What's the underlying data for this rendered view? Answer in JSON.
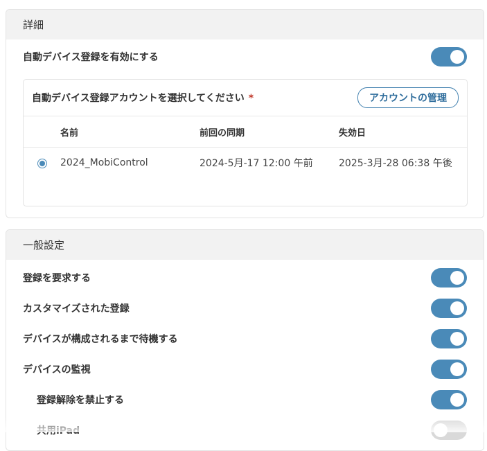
{
  "details": {
    "header": "詳細",
    "auto_enroll": {
      "label": "自動デバイス登録を有効にする",
      "enabled": true
    },
    "account_section": {
      "title": "自動デバイス登録アカウントを選択してください",
      "required_mark": "*",
      "manage_button": "アカウントの管理",
      "columns": [
        "名前",
        "前回の同期",
        "失効日"
      ],
      "rows": [
        {
          "selected": true,
          "name": "2024_MobiControl",
          "last_sync": "2024-5月-17 12:00 午前",
          "expires": "2025-3月-28 06:38 午後"
        }
      ]
    }
  },
  "general": {
    "header": "一般設定",
    "settings": [
      {
        "label": "登録を要求する",
        "enabled": true
      },
      {
        "label": "カスタマイズされた登録",
        "enabled": true
      },
      {
        "label": "デバイスが構成されるまで待機する",
        "enabled": true
      },
      {
        "label": "デバイスの監視",
        "enabled": true
      },
      {
        "label": "登録解除を禁止する",
        "enabled": true
      },
      {
        "label": "共用iPad",
        "enabled": false
      }
    ]
  },
  "colors": {
    "accent": "#4a8ab8",
    "toggle_off": "#d9d9d9",
    "required": "#c0392b",
    "header_bg": "#f2f2f2"
  }
}
